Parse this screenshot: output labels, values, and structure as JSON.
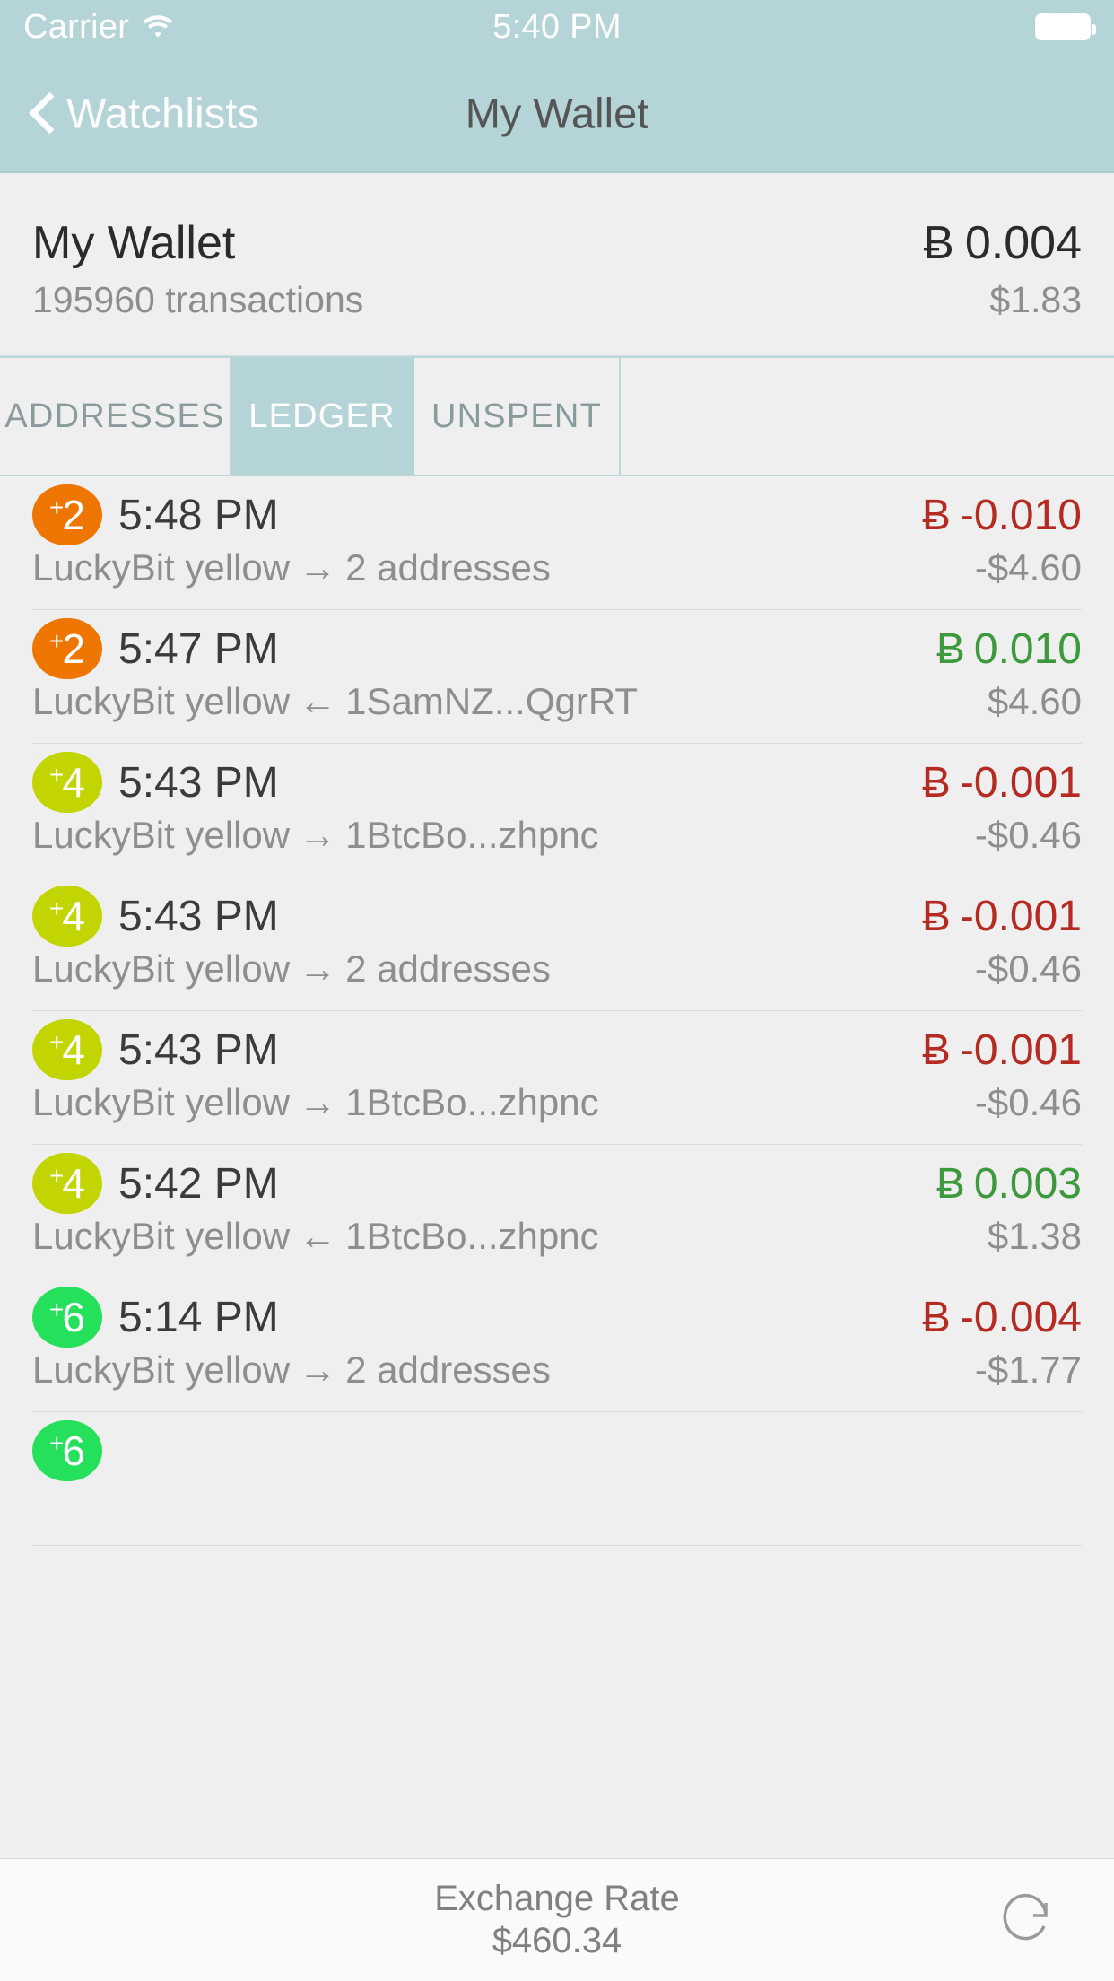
{
  "status_bar": {
    "carrier": "Carrier",
    "wifi_icon": "wifi-icon",
    "time": "5:40 PM",
    "battery_icon": "battery-full-icon"
  },
  "nav": {
    "back_icon": "chevron-left-icon",
    "back_label": "Watchlists",
    "title": "My Wallet"
  },
  "wallet": {
    "name": "My Wallet",
    "balance_symbol": "Ƀ",
    "balance": "0.004",
    "transactions": "195960 transactions",
    "fiat": "$1.83"
  },
  "tabs": [
    {
      "label": "ADDRESSES",
      "active": false
    },
    {
      "label": "LEDGER",
      "active": true
    },
    {
      "label": "UNSPENT",
      "active": false
    }
  ],
  "ledger": {
    "rows": [
      {
        "confirmations": "2",
        "badge_color": "#ee7600",
        "time": "5:48 PM",
        "source": "LuckyBit yellow",
        "arrow": "→",
        "target": "2 addresses",
        "amount_symbol": "Ƀ",
        "amount": "-0.010",
        "amount_sign": "neg",
        "fiat": "-$4.60"
      },
      {
        "confirmations": "2",
        "badge_color": "#ee7600",
        "time": "5:47 PM",
        "source": "LuckyBit yellow",
        "arrow": "←",
        "target": "1SamNZ...QgrRT",
        "amount_symbol": "Ƀ",
        "amount": "0.010",
        "amount_sign": "pos",
        "fiat": "$4.60"
      },
      {
        "confirmations": "4",
        "badge_color": "#c2d500",
        "time": "5:43 PM",
        "source": "LuckyBit yellow",
        "arrow": "→",
        "target": "1BtcBo...zhpnc",
        "amount_symbol": "Ƀ",
        "amount": "-0.001",
        "amount_sign": "neg",
        "fiat": "-$0.46"
      },
      {
        "confirmations": "4",
        "badge_color": "#c2d500",
        "time": "5:43 PM",
        "source": "LuckyBit yellow",
        "arrow": "→",
        "target": "2 addresses",
        "amount_symbol": "Ƀ",
        "amount": "-0.001",
        "amount_sign": "neg",
        "fiat": "-$0.46"
      },
      {
        "confirmations": "4",
        "badge_color": "#c2d500",
        "time": "5:43 PM",
        "source": "LuckyBit yellow",
        "arrow": "→",
        "target": "1BtcBo...zhpnc",
        "amount_symbol": "Ƀ",
        "amount": "-0.001",
        "amount_sign": "neg",
        "fiat": "-$0.46"
      },
      {
        "confirmations": "4",
        "badge_color": "#c2d500",
        "time": "5:42 PM",
        "source": "LuckyBit yellow",
        "arrow": "←",
        "target": "1BtcBo...zhpnc",
        "amount_symbol": "Ƀ",
        "amount": "0.003",
        "amount_sign": "pos",
        "fiat": "$1.38"
      },
      {
        "confirmations": "6",
        "badge_color": "#25e05a",
        "time": "5:14 PM",
        "source": "LuckyBit yellow",
        "arrow": "→",
        "target": "2 addresses",
        "amount_symbol": "Ƀ",
        "amount": "-0.004",
        "amount_sign": "neg",
        "fiat": "-$1.77"
      },
      {
        "confirmations": "6",
        "badge_color": "#25e05a",
        "time": "",
        "source": "",
        "arrow": "",
        "target": "",
        "amount_symbol": "",
        "amount": "",
        "amount_sign": "neg",
        "fiat": ""
      }
    ]
  },
  "bottom_bar": {
    "rate_label": "Exchange Rate",
    "rate_value": "$460.34",
    "refresh_icon": "refresh-icon"
  },
  "colors": {
    "accent_teal": "#b4d4d8",
    "negative_red": "#b52a21",
    "positive_green": "#3c9a3c",
    "badge_orange": "#ee7600",
    "badge_chartreuse": "#c2d500",
    "badge_green": "#25e05a",
    "page_background": "#efefef"
  }
}
